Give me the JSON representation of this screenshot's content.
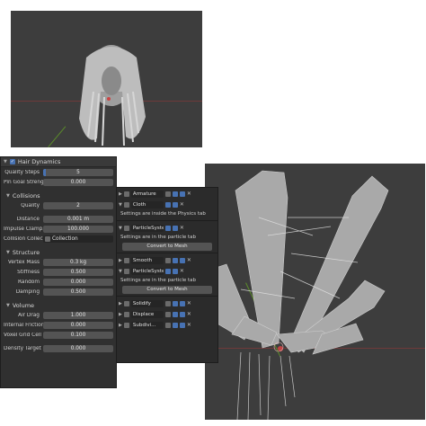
{
  "properties_panel": {
    "header": "Hair Dynamics",
    "quality_steps": {
      "label": "Quality Steps",
      "value": "5"
    },
    "pin_goal": {
      "label": "Pin Goal Streng",
      "value": "0.000"
    },
    "collisions": {
      "title": "Collisions",
      "quality": {
        "label": "Quality",
        "value": "2"
      },
      "distance": {
        "label": "Distance",
        "value": "0.001 m"
      },
      "impulse": {
        "label": "Impulse Clamp...",
        "value": "100.000"
      },
      "collection": {
        "label": "Collision Collec...",
        "value": "Collection"
      }
    },
    "structure": {
      "title": "Structure",
      "vertex_mass": {
        "label": "Vertex Mass",
        "value": "0.3 kg"
      },
      "stiffness": {
        "label": "Stiffness",
        "value": "0.500"
      },
      "random": {
        "label": "Random",
        "value": "0.000"
      },
      "damping": {
        "label": "Damping",
        "value": "0.500"
      }
    },
    "volume": {
      "title": "Volume",
      "air_drag": {
        "label": "Air Drag",
        "value": "1.000"
      },
      "internal_friction": {
        "label": "Internal Friction",
        "value": "0.000"
      },
      "voxel_grid": {
        "label": "Voxel Grid Cell ...",
        "value": "0.100"
      },
      "density_target": {
        "label": "Density Target",
        "value": "0.000"
      }
    }
  },
  "modifiers_panel": {
    "armature": "Armature",
    "cloth": "Cloth",
    "cloth_note": "Settings are inside the Physics tab",
    "particle0": "ParticleSystem 0",
    "particle_note_1": "Settings are in the particle tab",
    "convert_1": "Convert to Mesh",
    "smooth": "Smooth",
    "particle_sys": "ParticleSystem ...",
    "particle_note_2": "Settings are in the particle tab",
    "convert_2": "Convert to Mesh",
    "solidify": "Solidify",
    "displace": "Displace",
    "subdiv": "Subdivi..."
  },
  "colors": {
    "accent": "#4772b3",
    "viewport": "#3d3d3d",
    "panel": "#303030"
  }
}
